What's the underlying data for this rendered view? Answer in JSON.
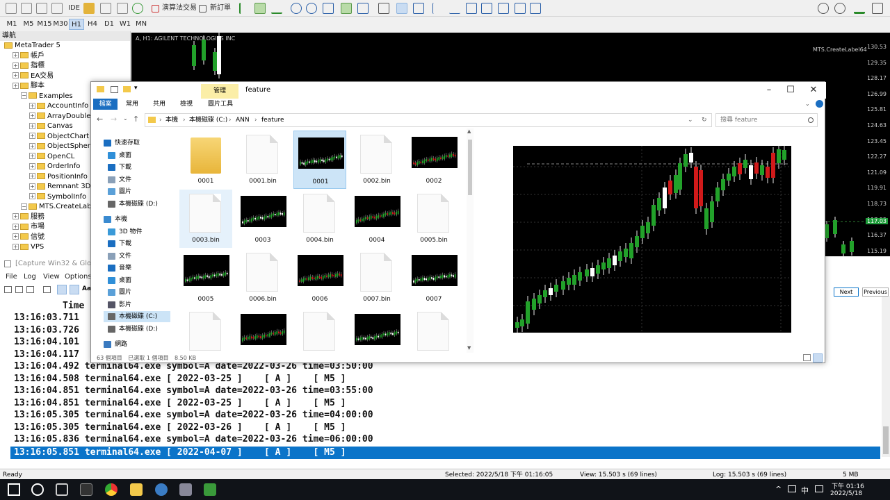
{
  "mt_toolbar": {
    "ide_label": "IDE",
    "algo_trading_label": "演算法交易",
    "new_order_label": "新訂單"
  },
  "timeframes": [
    "M1",
    "M5",
    "M15",
    "M30",
    "H1",
    "H4",
    "D1",
    "W1",
    "MN"
  ],
  "active_timeframe": "H1",
  "navigator": {
    "title": "導航",
    "items": [
      {
        "label": "MetaTrader 5",
        "level": 0
      },
      {
        "label": "帳戶",
        "level": 1
      },
      {
        "label": "指標",
        "level": 1
      },
      {
        "label": "EA交易",
        "level": 1
      },
      {
        "label": "腳本",
        "level": 1
      },
      {
        "label": "Examples",
        "level": 2
      },
      {
        "label": "AccountInfo",
        "level": 3
      },
      {
        "label": "ArrayDouble",
        "level": 3
      },
      {
        "label": "Canvas",
        "level": 3
      },
      {
        "label": "ObjectChart",
        "level": 3
      },
      {
        "label": "ObjectSphere",
        "level": 3
      },
      {
        "label": "OpenCL",
        "level": 3
      },
      {
        "label": "OrderInfo",
        "level": 3
      },
      {
        "label": "PositionInfo",
        "level": 3
      },
      {
        "label": "Remnant 3D",
        "level": 3
      },
      {
        "label": "SymbolInfo",
        "level": 3
      },
      {
        "label": "MTS.CreateLabel64",
        "level": 2
      },
      {
        "label": "服務",
        "level": 1
      },
      {
        "label": "市場",
        "level": 1
      },
      {
        "label": "信號",
        "level": 1
      },
      {
        "label": "VPS",
        "level": 1
      }
    ]
  },
  "mt_chart": {
    "title": "A, H1: AGILENT TECHNOLOGIES INC",
    "ea_label": "MTS.CreateLabel64",
    "current_price": "117.03",
    "price_scale": [
      "130.53",
      "129.35",
      "128.17",
      "126.99",
      "125.81",
      "124.63",
      "123.45",
      "122.27",
      "121.09",
      "119.91",
      "118.73",
      "117.55",
      "116.37",
      "115.19"
    ]
  },
  "capture_window": {
    "title": "[Capture Win32 & Global Win",
    "menu": [
      "File",
      "Log",
      "View",
      "Options"
    ],
    "column_header": "Time",
    "lines": [
      "13:16:03.711",
      "13:16:03.726",
      "13:16:04.101",
      "13:16:04.117",
      "13:16:04.492 terminal64.exe symbol=A date=2022-03-26 time=03:50:00",
      "13:16:04.508 terminal64.exe [ 2022-03-25 ]    [ A ]    [ M5 ]",
      "13:16:04.851 terminal64.exe symbol=A date=2022-03-26 time=03:55:00",
      "13:16:04.851 terminal64.exe [ 2022-03-25 ]    [ A ]    [ M5 ]",
      "13:16:05.305 terminal64.exe symbol=A date=2022-03-26 time=04:00:00",
      "13:16:05.305 terminal64.exe [ 2022-03-26 ]    [ A ]    [ M5 ]",
      "13:16:05.836 terminal64.exe symbol=A date=2022-03-26 time=06:00:00"
    ],
    "highlighted_line": "13:16:05.851 terminal64.exe [ 2022-04-07 ]    [ A ]    [ M5 ]",
    "next_label": "Next",
    "previous_label": "Previous"
  },
  "status_bar": {
    "ready": "Ready",
    "selected": "Selected: 2022/5/18 下午 01:16:05",
    "view": "View: 15.503 s (69 lines)",
    "log": "Log: 15.503 s (69 lines)",
    "size": "5 MB"
  },
  "taskbar": {
    "time": "下午 01:16",
    "date": "2022/5/18",
    "ime": "中"
  },
  "explorer": {
    "manage_tab": "管理",
    "window_title": "feature",
    "ribbon_tabs": [
      "檔案",
      "常用",
      "共用",
      "檢視"
    ],
    "picture_tools": "圖片工具",
    "breadcrumb": [
      "本機",
      "本機磁碟 (C:)",
      "ANN",
      "feature"
    ],
    "search_placeholder": "搜尋 feature",
    "sidebar": [
      {
        "label": "快速存取",
        "icon": "star-icon"
      },
      {
        "label": "桌面",
        "icon": "desktop-icon"
      },
      {
        "label": "下載",
        "icon": "download-icon"
      },
      {
        "label": "文件",
        "icon": "document-icon"
      },
      {
        "label": "圖片",
        "icon": "picture-icon"
      },
      {
        "label": "本機磁碟 (D:)",
        "icon": "drive-icon"
      },
      {
        "label": "本機",
        "icon": "computer-icon"
      },
      {
        "label": "3D 物件",
        "icon": "cube-icon"
      },
      {
        "label": "下載",
        "icon": "download-icon"
      },
      {
        "label": "文件",
        "icon": "document-icon"
      },
      {
        "label": "音樂",
        "icon": "music-icon"
      },
      {
        "label": "桌面",
        "icon": "desktop-icon"
      },
      {
        "label": "圖片",
        "icon": "picture-icon"
      },
      {
        "label": "影片",
        "icon": "video-icon"
      },
      {
        "label": "本機磁碟 (C:)",
        "icon": "drive-icon"
      },
      {
        "label": "本機磁碟 (D:)",
        "icon": "drive-icon"
      },
      {
        "label": "網路",
        "icon": "network-icon"
      }
    ],
    "files": [
      {
        "name": "0001",
        "kind": "folder"
      },
      {
        "name": "0001.bin",
        "kind": "bin"
      },
      {
        "name": "0001",
        "kind": "image",
        "selected": true
      },
      {
        "name": "0002.bin",
        "kind": "bin"
      },
      {
        "name": "0002",
        "kind": "image"
      },
      {
        "name": "0003.bin",
        "kind": "bin",
        "hover": true
      },
      {
        "name": "0003",
        "kind": "image"
      },
      {
        "name": "0004.bin",
        "kind": "bin"
      },
      {
        "name": "0004",
        "kind": "image"
      },
      {
        "name": "0005.bin",
        "kind": "bin"
      },
      {
        "name": "0005",
        "kind": "image"
      },
      {
        "name": "0006.bin",
        "kind": "bin"
      },
      {
        "name": "0006",
        "kind": "image"
      },
      {
        "name": "0007.bin",
        "kind": "bin"
      },
      {
        "name": "0007",
        "kind": "image"
      },
      {
        "name": "",
        "kind": "bin"
      },
      {
        "name": "",
        "kind": "image"
      },
      {
        "name": "",
        "kind": "bin"
      },
      {
        "name": "",
        "kind": "image"
      },
      {
        "name": "",
        "kind": "bin"
      }
    ],
    "status_items": "63 個項目",
    "status_selected": "已選取 1 個項目",
    "status_size": "8.50 KB"
  },
  "colors": {
    "bull": "#22a12a",
    "bear": "#d11a1a",
    "selection": "#0b74c9"
  }
}
